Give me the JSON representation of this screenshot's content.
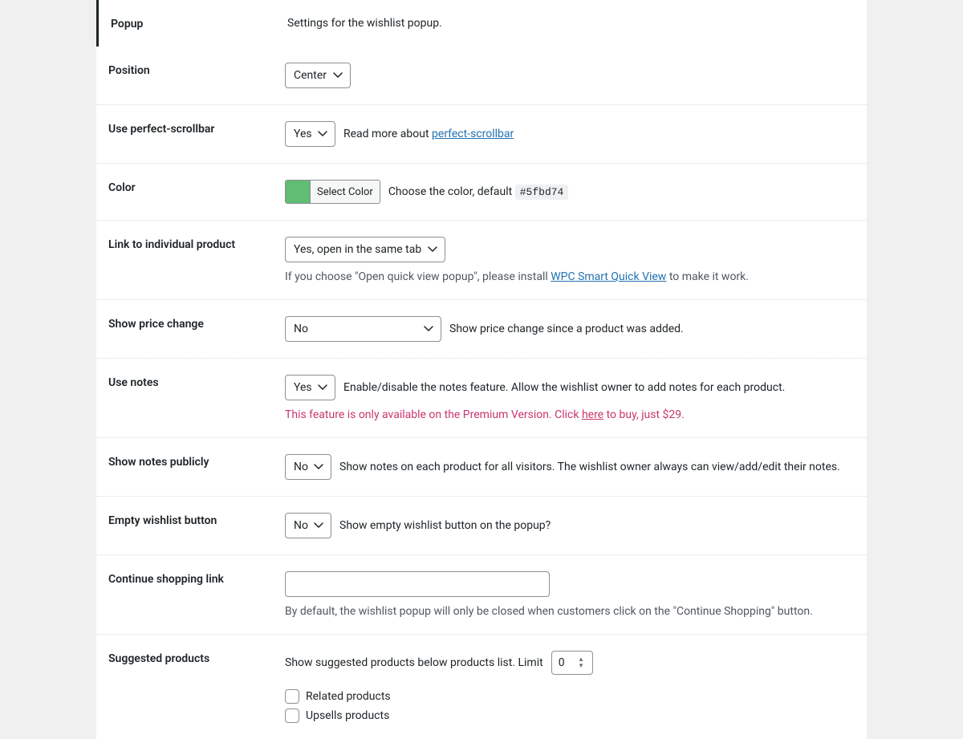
{
  "header": {
    "title": "Popup",
    "desc": "Settings for the wishlist popup."
  },
  "position": {
    "label": "Position",
    "value": "Center"
  },
  "scrollbar": {
    "label": "Use perfect-scrollbar",
    "value": "Yes",
    "desc_prefix": "Read more about ",
    "link_text": "perfect-scrollbar"
  },
  "color": {
    "label": "Color",
    "btn": "Select Color",
    "swatch": "#5fbd74",
    "desc_prefix": "Choose the color, default ",
    "code": "#5fbd74"
  },
  "link_product": {
    "label": "Link to individual product",
    "value": "Yes, open in the same tab",
    "help_prefix": "If you choose \"Open quick view popup\", please install ",
    "help_link": "WPC Smart Quick View",
    "help_suffix": " to make it work."
  },
  "price_change": {
    "label": "Show price change",
    "value": "No",
    "desc": "Show price change since a product was added."
  },
  "use_notes": {
    "label": "Use notes",
    "value": "Yes",
    "desc": "Enable/disable the notes feature. Allow the wishlist owner to add notes for each product.",
    "premium_prefix": "This feature is only available on the Premium Version. Click ",
    "premium_link": "here",
    "premium_suffix": " to buy, just $29."
  },
  "show_notes_pub": {
    "label": "Show notes publicly",
    "value": "No",
    "desc": "Show notes on each product for all visitors. The wishlist owner always can view/add/edit their notes."
  },
  "empty_btn": {
    "label": "Empty wishlist button",
    "value": "No",
    "desc": "Show empty wishlist button on the popup?"
  },
  "continue": {
    "label": "Continue shopping link",
    "value": "",
    "help": "By default, the wishlist popup will only be closed when customers click on the \"Continue Shopping\" button."
  },
  "suggested": {
    "label": "Suggested products",
    "desc": "Show suggested products below products list. Limit",
    "limit": "0",
    "cb1": "Related products",
    "cb2": "Upsells products"
  }
}
